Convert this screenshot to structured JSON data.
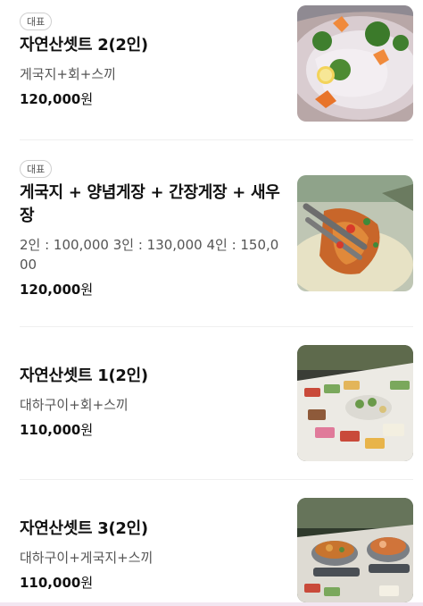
{
  "menu": {
    "items": [
      {
        "badge": "대표",
        "name": "자연산셋트 2(2인)",
        "desc": "게국지+회+스끼",
        "price": "120,000",
        "unit": "원",
        "photo": "sashimi-platter-photo"
      },
      {
        "badge": "대표",
        "name": "게국지 + 양념게장 + 간장게장 + 새우장",
        "desc": "2인 : 100,000 3인 : 130,000 4인 : 150,000",
        "price": "120,000",
        "unit": "원",
        "photo": "seasoned-crab-photo"
      },
      {
        "name": "자연산셋트 1(2인)",
        "desc": "대하구이+회+스끼",
        "price": "110,000",
        "unit": "원",
        "photo": "table-spread-photo"
      },
      {
        "name": "자연산셋트 3(2인)",
        "desc": "대하구이+게국지+스끼",
        "price": "110,000",
        "unit": "원",
        "photo": "hotpot-table-photo"
      }
    ]
  },
  "colors": {
    "text": "#111111",
    "subtext": "#555555",
    "badge_border": "#cfcfcf",
    "divider": "#efefef"
  }
}
